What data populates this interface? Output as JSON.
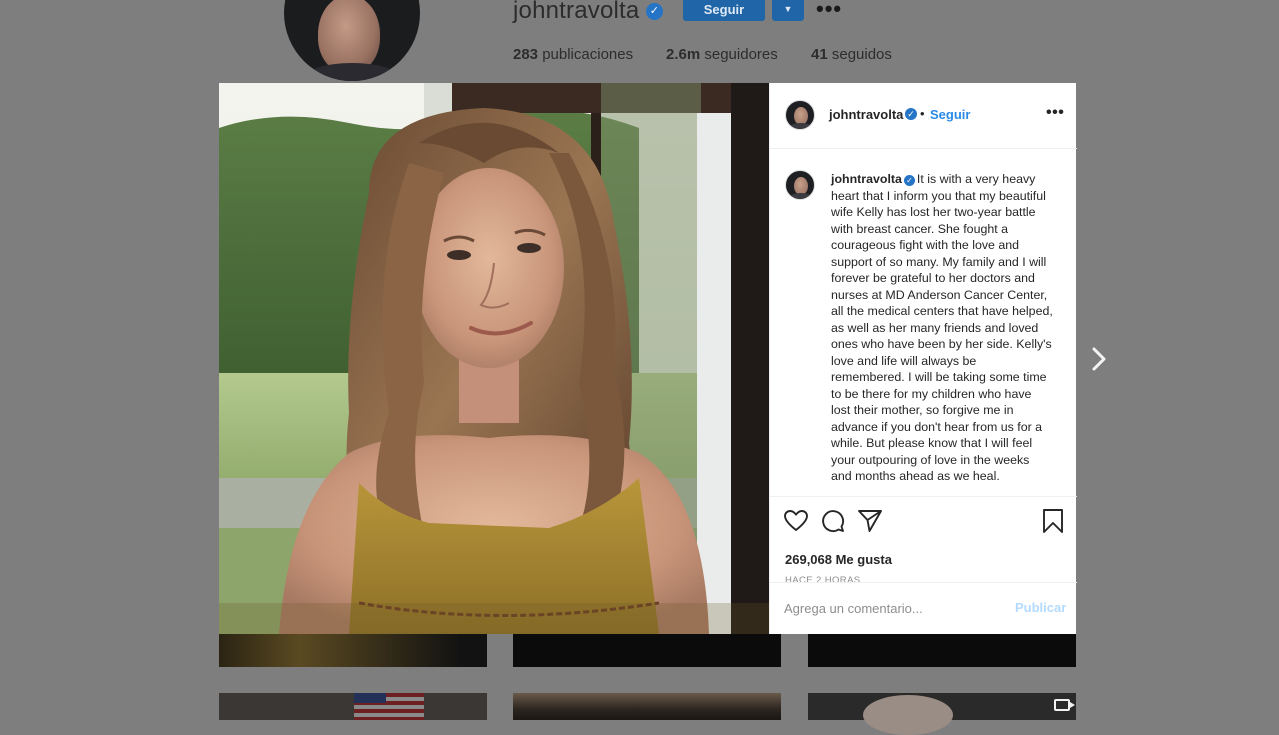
{
  "profile": {
    "username": "johntravolta",
    "follow_label": "Seguir",
    "more_icon": "more-horizontal-icon",
    "stats": [
      {
        "number": "283",
        "label": " publicaciones"
      },
      {
        "number": "2.6m",
        "label": " seguidores"
      },
      {
        "number": "41",
        "label": " seguidos"
      }
    ]
  },
  "post": {
    "header": {
      "username": "johntravolta",
      "separator": "•",
      "follow_label": "Seguir"
    },
    "caption": {
      "username": "johntravolta",
      "text": "It is with a very heavy heart that I inform you that my beautiful wife Kelly has lost her two-year battle with breast cancer. She fought a courageous fight with the love and support of so many.  My family and I will forever be grateful to her doctors and nurses at MD Anderson Cancer Center, all the medical centers that have helped, as well as her many friends and loved ones who have been by her side. Kelly's love and life will always be remembered. I will be taking some time to be there for my children who have lost their mother, so forgive me in advance if you don't hear from us for a while.  But please know that I will feel your outpouring of love in the weeks and months ahead as we heal."
    },
    "likes": "269,068 Me gusta",
    "time": "HACE 2 HORAS",
    "comment": {
      "placeholder": "Agrega un comentario...",
      "value": "",
      "publish_label": "Publicar"
    }
  },
  "colors": {
    "accent": "#0095f6",
    "overlay_bg": "#7e7e7e",
    "verified": "#2574c6"
  }
}
